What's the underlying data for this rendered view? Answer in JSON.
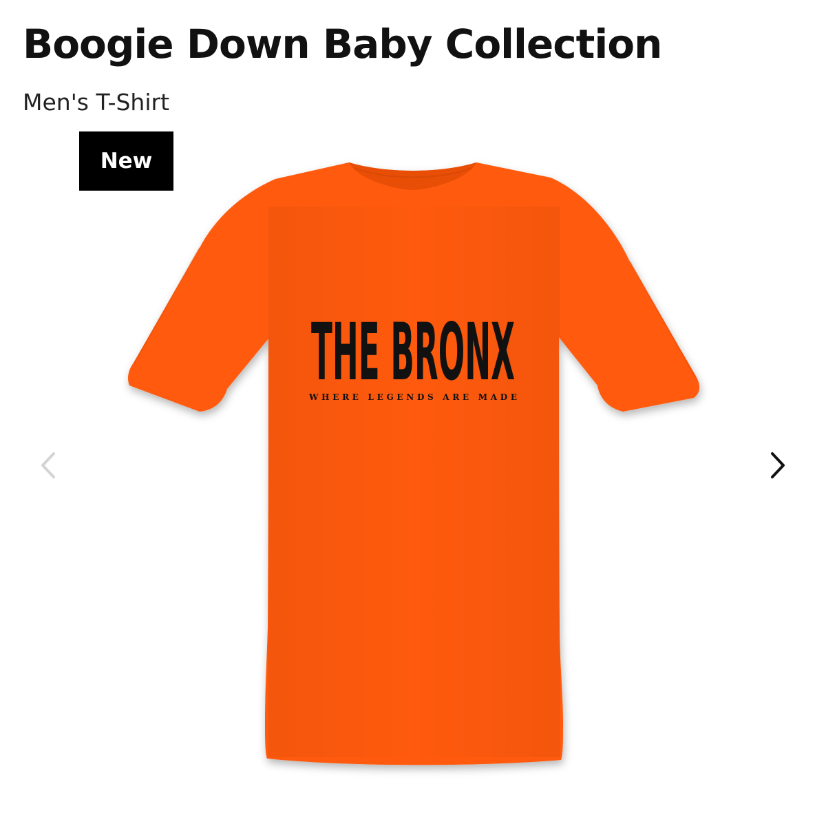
{
  "product": {
    "title": "Boogie Down Baby Collection",
    "subtitle": "Men's T-Shirt",
    "badge": "New"
  },
  "shirt": {
    "color": "#ff5a0a",
    "print_headline": "THE BRONX",
    "print_tagline": "WHERE LEGENDS ARE MADE",
    "print_color": "#111111"
  },
  "gallery": {
    "prev_icon": "chevron-left-icon",
    "next_icon": "chevron-right-icon",
    "prev_color": "#d4d4d4",
    "next_color": "#111111"
  }
}
